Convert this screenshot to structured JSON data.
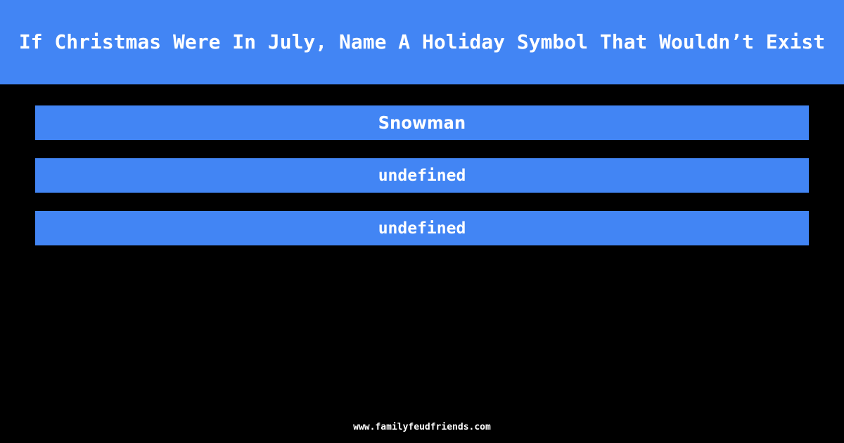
{
  "theme": {
    "background_color": "#000000",
    "accent_color": "#4285F4",
    "text_color": "#FFFFFF"
  },
  "header": {
    "question": "If Christmas Were In July, Name A Holiday Symbol That Wouldn’t Exist"
  },
  "answers": [
    {
      "label": "Snowman",
      "state": "revealed"
    },
    {
      "label": "undefined",
      "state": "undefined"
    },
    {
      "label": "undefined",
      "state": "undefined"
    }
  ],
  "footer": {
    "url": "www.familyfeudfriends.com"
  }
}
